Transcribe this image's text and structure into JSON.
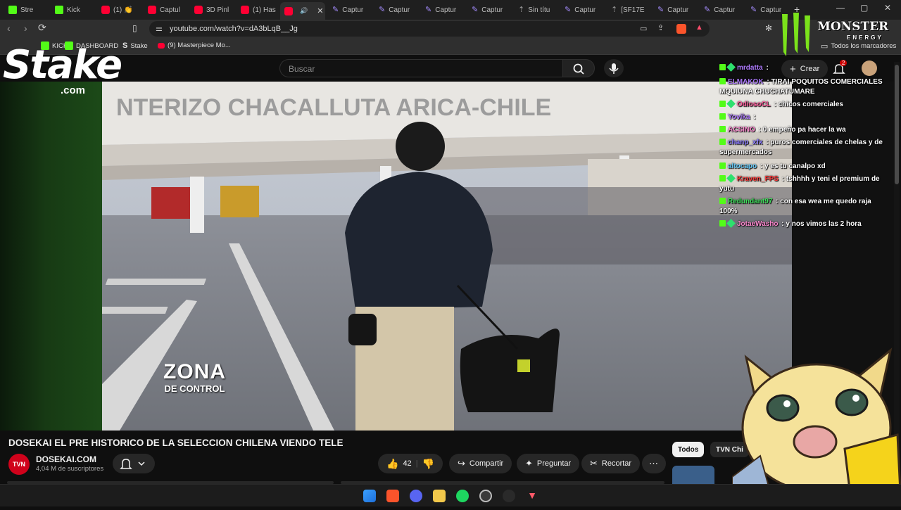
{
  "browser": {
    "tabs": [
      {
        "label": "Stre",
        "icon": "kick-icon",
        "active": false
      },
      {
        "label": "Kick",
        "icon": "kick-icon",
        "active": false
      },
      {
        "label": "(1) 👏",
        "icon": "youtube-icon",
        "active": false
      },
      {
        "label": "Captul",
        "icon": "youtube-icon",
        "active": false
      },
      {
        "label": "3D Pinl",
        "icon": "youtube-icon",
        "active": false
      },
      {
        "label": "(1) Has",
        "icon": "youtube-icon",
        "active": false
      },
      {
        "label": "",
        "icon": "youtube-icon",
        "active": true
      },
      {
        "label": "Captur",
        "icon": "capture-icon",
        "active": false
      },
      {
        "label": "Captur",
        "icon": "capture-icon",
        "active": false
      },
      {
        "label": "Captur",
        "icon": "capture-icon",
        "active": false
      },
      {
        "label": "Captur",
        "icon": "capture-icon",
        "active": false
      },
      {
        "label": "Sin títu",
        "icon": "doc-icon",
        "active": false
      },
      {
        "label": "Captur",
        "icon": "capture-icon",
        "active": false
      },
      {
        "label": "[SF17E",
        "icon": "doc-icon",
        "active": false
      },
      {
        "label": "Captur",
        "icon": "capture-icon",
        "active": false
      },
      {
        "label": "Captur",
        "icon": "capture-icon",
        "active": false
      },
      {
        "label": "Captur",
        "icon": "capture-icon",
        "active": false
      }
    ],
    "url": "youtube.com/watch?v=dA3bLqB__Jg",
    "bookmarks": [
      {
        "label": "KICK",
        "icon": "kick-icon"
      },
      {
        "label": "DASHBOARD",
        "icon": "kick-icon"
      },
      {
        "label": "Stake",
        "icon": "stake-icon"
      },
      {
        "label": "(9) Masterpiece Mo...",
        "icon": "youtube-icon"
      }
    ],
    "all_bookmarks_label": "Todos los marcadores"
  },
  "youtube": {
    "search_placeholder": "Buscar",
    "create_label": "Crear",
    "notification_count": "2",
    "video_title": "DOSEKAI EL PRE HISTORICO DE LA SELECCION CHILENA VIENDO TELE",
    "channel_name": "DOSEKAI.COM",
    "channel_avatar_text": "TVN",
    "subscribers": "4,04 M de suscriptores",
    "likes": "42",
    "share_label": "Compartir",
    "ask_label": "Preguntar",
    "clip_label": "Recortar",
    "chips": [
      "Todos",
      "TVN Chi"
    ]
  },
  "video_overlay": {
    "caption_line1": "ZONA",
    "caption_line2": "DE CONTROL",
    "sign_text": "NTERIZO CHACALLUTA ARICA-CHILE"
  },
  "overlays": {
    "stake_word": "Stake",
    "stake_domain": ".com",
    "monster_word": "MONSTER",
    "monster_sub": "ENERGY"
  },
  "chat": [
    {
      "user": "mrdatta",
      "user_color": "#b07cff",
      "text": "",
      "badges": [
        "kick",
        "emote"
      ]
    },
    {
      "user": "ELMAKOK",
      "user_color": "#b07cff",
      "text": "TIRAI POQUITOS COMERCIALES MQUIUNA CHUCHATUMARE",
      "badges": [
        "kick"
      ]
    },
    {
      "user": "OdiosoCL",
      "user_color": "#ff5a9b",
      "text": "chicos comerciales",
      "badges": [
        "kick",
        "emote"
      ]
    },
    {
      "user": "Yovika",
      "user_color": "#b07cff",
      "text": "",
      "badges": [
        "kick"
      ]
    },
    {
      "user": "ACSINO",
      "user_color": "#ff8ad1",
      "text": "0 empeño pa hacer la wa",
      "badges": [
        "kick"
      ]
    },
    {
      "user": "chanp_xfx",
      "user_color": "#8c7cff",
      "text": "puros comerciales de chelas y de supermercados",
      "badges": [
        "kick"
      ]
    },
    {
      "user": "altocapo",
      "user_color": "#6ad0ff",
      "text": "y es tu canalpo xd",
      "badges": [
        "kick"
      ]
    },
    {
      "user": "Kraven_FPS",
      "user_color": "#ff3b3b",
      "text": "tshhhh y teni el premium de yutu",
      "badges": [
        "kick",
        "emote"
      ]
    },
    {
      "user": "Redundant97",
      "user_color": "#3fe35d",
      "text": "con esa wea me quedo raja 100%",
      "badges": [
        "kick"
      ]
    },
    {
      "user": "JotaeWasho",
      "user_color": "#ff8ad1",
      "text": "y nos vimos las 2 hora",
      "badges": [
        "kick",
        "emote"
      ]
    }
  ]
}
